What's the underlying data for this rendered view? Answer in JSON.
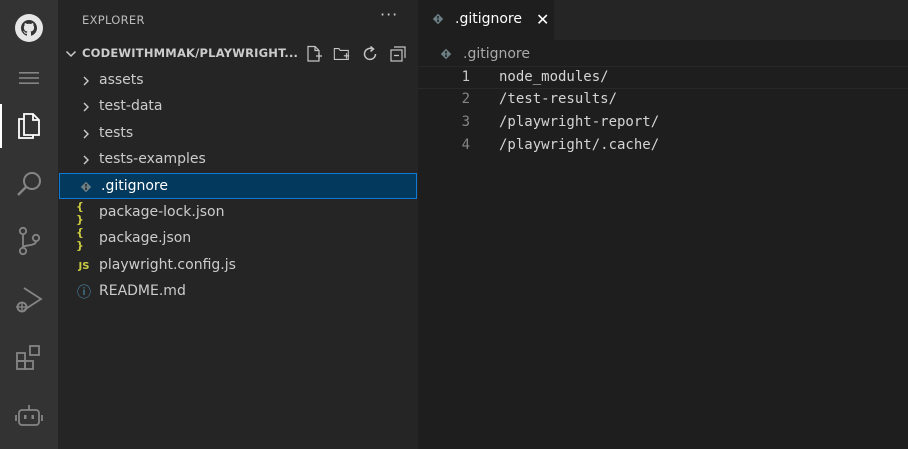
{
  "colors": {
    "activity_bar_bg": "#333333",
    "sidebar_bg": "#252526",
    "editor_bg": "#1e1e1e",
    "selection_bg": "#04395e",
    "selection_border": "#0e7ad6",
    "json_icon": "#cbcb41",
    "js_icon": "#cbcb41",
    "info_icon": "#519aba",
    "git_icon": "#6d8086"
  },
  "activity_bar": {
    "items": [
      {
        "name": "github-icon"
      },
      {
        "name": "menu-icon"
      },
      {
        "name": "explorer-icon",
        "active": true
      },
      {
        "name": "search-icon"
      },
      {
        "name": "source-control-icon"
      },
      {
        "name": "run-debug-icon"
      },
      {
        "name": "extensions-icon"
      },
      {
        "name": "copilot-icon"
      }
    ]
  },
  "sidebar": {
    "title": "EXPLORER",
    "more": "···",
    "root": {
      "label": "CODEWITHMMAK/PLAYWRIGHT...",
      "actions": [
        "new-file-icon",
        "new-folder-icon",
        "refresh-icon",
        "collapse-all-icon"
      ]
    },
    "items": [
      {
        "label": "assets",
        "type": "folder",
        "icon": "chevron-right-icon"
      },
      {
        "label": "test-data",
        "type": "folder",
        "icon": "chevron-right-icon"
      },
      {
        "label": "tests",
        "type": "folder",
        "icon": "chevron-right-icon"
      },
      {
        "label": "tests-examples",
        "type": "folder",
        "icon": "chevron-right-icon"
      },
      {
        "label": ".gitignore",
        "type": "file",
        "icon": "git-file-icon",
        "selected": true
      },
      {
        "label": "package-lock.json",
        "type": "file",
        "icon": "json-file-icon",
        "glyph": "{ }"
      },
      {
        "label": "package.json",
        "type": "file",
        "icon": "json-file-icon",
        "glyph": "{ }"
      },
      {
        "label": "playwright.config.js",
        "type": "file",
        "icon": "js-file-icon",
        "glyph": "JS"
      },
      {
        "label": "README.md",
        "type": "file",
        "icon": "info-file-icon",
        "glyph": "ⓘ"
      }
    ]
  },
  "editor": {
    "tab": {
      "label": ".gitignore",
      "close": "✕",
      "icon": "git-file-icon"
    },
    "breadcrumb": {
      "label": ".gitignore",
      "icon": "git-file-icon"
    },
    "lines": [
      {
        "number": "1",
        "text": "node_modules/"
      },
      {
        "number": "2",
        "text": "/test-results/"
      },
      {
        "number": "3",
        "text": "/playwright-report/"
      },
      {
        "number": "4",
        "text": "/playwright/.cache/"
      }
    ]
  }
}
